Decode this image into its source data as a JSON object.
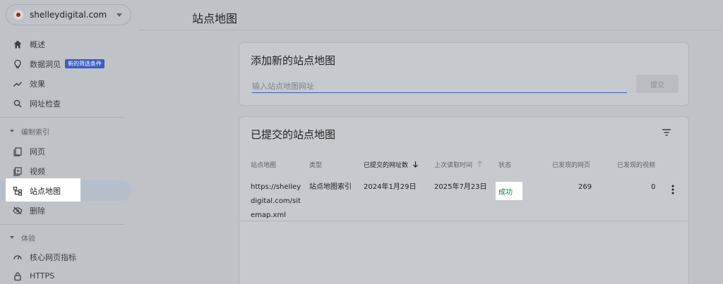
{
  "property": {
    "name": "shelleydigital.com"
  },
  "nav": {
    "overview": "概述",
    "insights": "数据洞见",
    "insights_badge": "新的筛选条件",
    "performance": "效果",
    "url_inspection": "网址检查",
    "indexing_section": "编制索引",
    "pages": "网页",
    "videos": "视频",
    "sitemaps": "站点地图",
    "removals": "删除",
    "experience_section": "体验",
    "core_web_vitals": "核心网页指标",
    "https": "HTTPS"
  },
  "page": {
    "title": "站点地图"
  },
  "add_card": {
    "title": "添加新的站点地图",
    "input_placeholder": "输入站点地图网址",
    "submit_label": "提交"
  },
  "submitted_card": {
    "title": "已提交的站点地图",
    "columns": [
      "站点地图",
      "类型",
      "已提交的网址数",
      "上次读取时间",
      "状态",
      "已发现的网页",
      "已发现的视频"
    ],
    "rows": [
      {
        "sitemap_line1": "https://shelley",
        "sitemap_line2": "digital.com/sit",
        "sitemap_line3": "emap.xml",
        "type": "站点地图索引",
        "submitted": "2024年1月29日",
        "last_read": "2025年7月23日",
        "status": "成功",
        "pages": "269",
        "videos": "0"
      }
    ]
  },
  "colors": {
    "accent": "#3b5cc4",
    "success": "#188038"
  }
}
